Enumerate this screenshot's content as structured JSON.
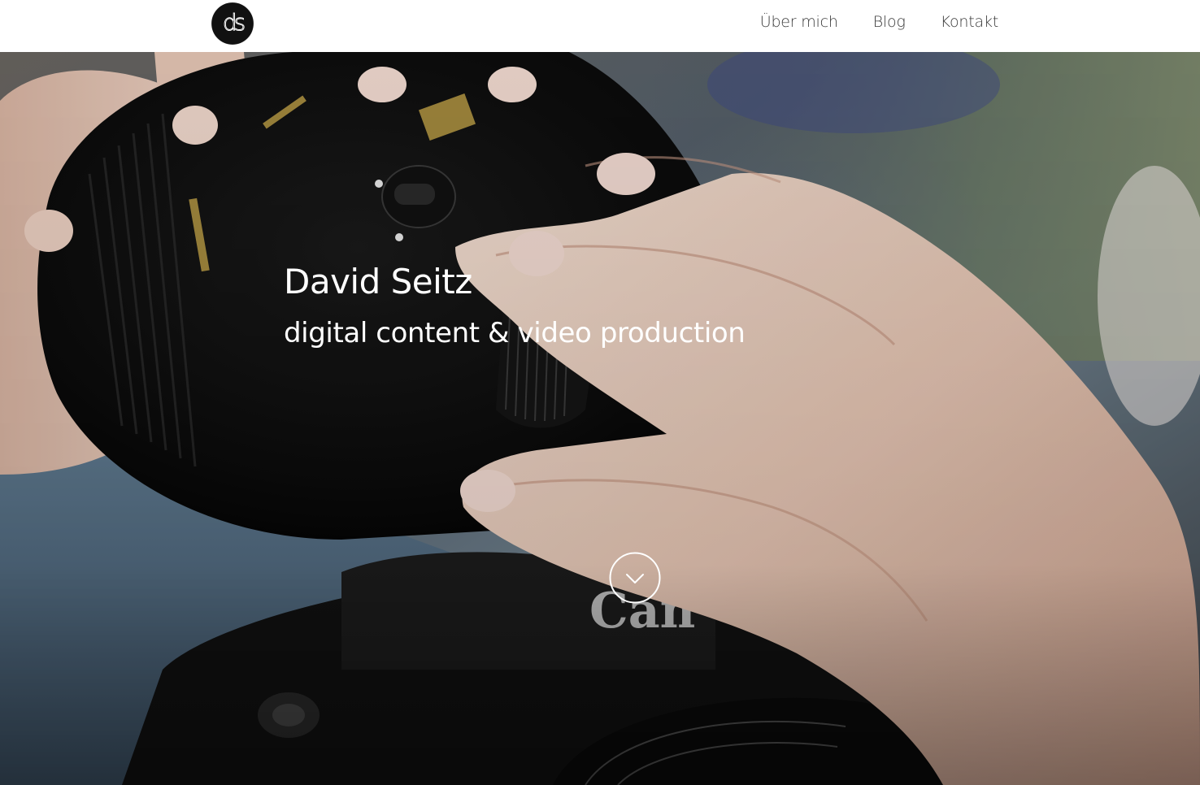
{
  "header": {
    "logo_text": "ds",
    "nav": [
      {
        "label": "Über mich"
      },
      {
        "label": "Blog"
      },
      {
        "label": "Kontakt"
      }
    ]
  },
  "hero": {
    "title": "David Seitz",
    "subtitle": "digital content & video production",
    "scroll_icon": "chevron-down-icon"
  },
  "colors": {
    "header_bg": "#ffffff",
    "nav_text": "#3a3a3a",
    "hero_text": "#ffffff",
    "logo_bg": "#111111"
  }
}
